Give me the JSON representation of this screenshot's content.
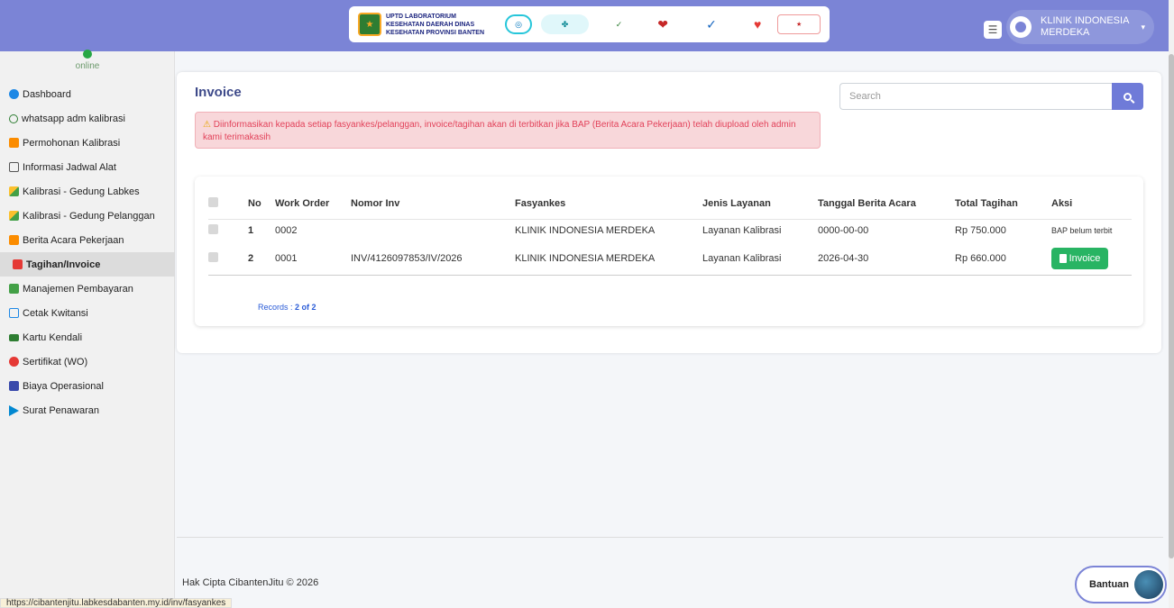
{
  "header": {
    "logo_text": "UPTD LABORATORIUM KESEHATAN DAERAH DINAS KESEHATAN PROVINSI BANTEN",
    "logos": [
      "cibanten-jitu-logo",
      "kemenkes-logo",
      "germas-logo",
      "heart-logo",
      "kan-logo",
      "love-logo",
      "berakhlak-logo"
    ],
    "user_name": "KLINIK INDONESIA MERDEKA",
    "accent_color": "#7b84d6"
  },
  "sidebar": {
    "status": "online",
    "items": [
      {
        "label": "Dashboard",
        "icon": "dashboard-icon"
      },
      {
        "label": "whatsapp adm kalibrasi",
        "icon": "whatsapp-icon"
      },
      {
        "label": "Permohonan Kalibrasi",
        "icon": "folder-icon"
      },
      {
        "label": "Informasi Jadwal Alat",
        "icon": "calendar-icon"
      },
      {
        "label": "Kalibrasi - Gedung Labkes",
        "icon": "handshake-icon"
      },
      {
        "label": "Kalibrasi - Gedung Pelanggan",
        "icon": "handshake-icon"
      },
      {
        "label": "Berita Acara Pekerjaan",
        "icon": "folder-icon"
      },
      {
        "label": "Tagihan/Invoice",
        "icon": "invoice-icon",
        "active": true
      },
      {
        "label": "Manajemen Pembayaran",
        "icon": "money-icon"
      },
      {
        "label": "Cetak Kwitansi",
        "icon": "print-icon"
      },
      {
        "label": "Kartu Kendali",
        "icon": "card-icon"
      },
      {
        "label": "Sertifikat (WO)",
        "icon": "certificate-icon"
      },
      {
        "label": "Biaya Operasional",
        "icon": "calculator-icon"
      },
      {
        "label": "Surat Penawaran",
        "icon": "send-icon"
      }
    ]
  },
  "main": {
    "title": "Invoice",
    "alert": {
      "icon": "warning-icon",
      "text": "Diinformasikan kepada setiap fasyankes/pelanggan, invoice/tagihan akan di terbitkan jika BAP (Berita Acara Pekerjaan) telah diupload oleh admin kami terimakasih"
    },
    "search": {
      "placeholder": "Search",
      "value": ""
    },
    "table": {
      "columns": [
        "No",
        "Work Order",
        "Nomor Inv",
        "Fasyankes",
        "Jenis Layanan",
        "Tanggal Berita Acara",
        "Total Tagihan",
        "Aksi"
      ],
      "rows": [
        {
          "no": "1",
          "work_order": "0002",
          "nomor_inv": "",
          "fasyankes": "KLINIK INDONESIA MERDEKA",
          "jenis_layanan": "Layanan Kalibrasi",
          "tanggal": "0000-00-00",
          "total": "Rp 750.000",
          "aksi": "BAP belum terbit"
        },
        {
          "no": "2",
          "work_order": "0001",
          "nomor_inv": "INV/4126097853/IV/2026",
          "fasyankes": "KLINIK INDONESIA MERDEKA",
          "jenis_layanan": "Layanan Kalibrasi",
          "tanggal": "2026-04-30",
          "total": "Rp 660.000",
          "aksi": "Invoice"
        }
      ],
      "records_label": "Records : ",
      "records_value": "2 of 2"
    }
  },
  "footer": {
    "text": "Hak Cipta CibantenJitu © 2026"
  },
  "help": {
    "label": "Bantuan"
  },
  "statusbar": {
    "url": "https://cibantenjitu.labkesdabanten.my.id/inv/fasyankes"
  }
}
